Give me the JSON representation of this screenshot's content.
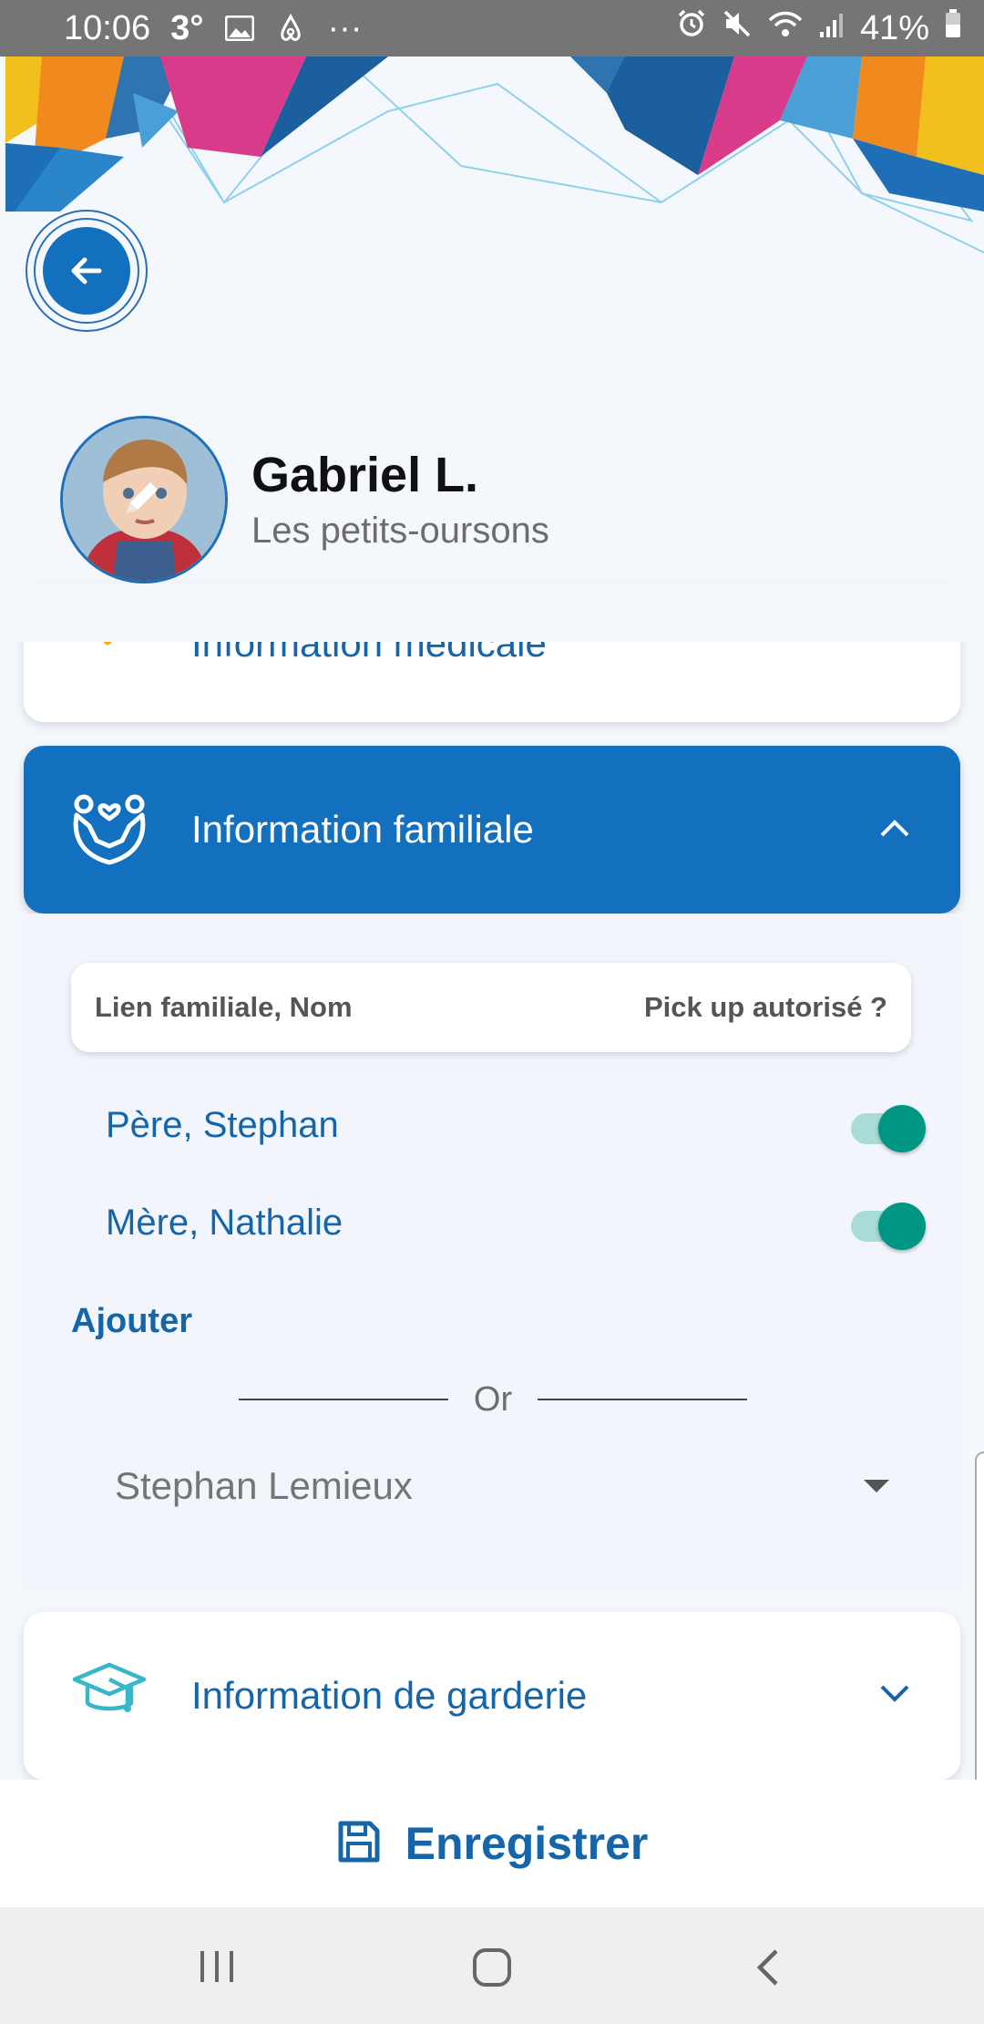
{
  "status_bar": {
    "time": "10:06",
    "temperature": "3°",
    "notification_more": "···",
    "battery": "41%",
    "icons": [
      "image-icon",
      "airbnb-icon",
      "alarm-icon",
      "mute-icon",
      "wifi-icon",
      "signal-icon",
      "battery-icon"
    ]
  },
  "profile": {
    "name": "Gabriel L.",
    "group": "Les petits-oursons"
  },
  "sections": {
    "medical": {
      "title": "Information médicale",
      "expanded": false
    },
    "family": {
      "title": "Information familiale",
      "expanded": true,
      "table_header": {
        "left": "Lien familiale, Nom",
        "right": "Pick up autorisé ?"
      },
      "members": [
        {
          "label": "Père, Stephan",
          "pickup_authorized": true
        },
        {
          "label": "Mère, Nathalie",
          "pickup_authorized": true
        }
      ],
      "add_label": "Ajouter",
      "or_label": "Or",
      "select_value": "Stephan Lemieux"
    },
    "garderie": {
      "title": "Information de garderie",
      "expanded": false
    }
  },
  "save": {
    "label": "Enregistrer"
  },
  "colors": {
    "primary": "#1270bf",
    "text_primary": "#1565a8",
    "toggle_on": "#009684",
    "medical_icon": "#f5a623",
    "garderie_icon": "#36b8c9"
  }
}
